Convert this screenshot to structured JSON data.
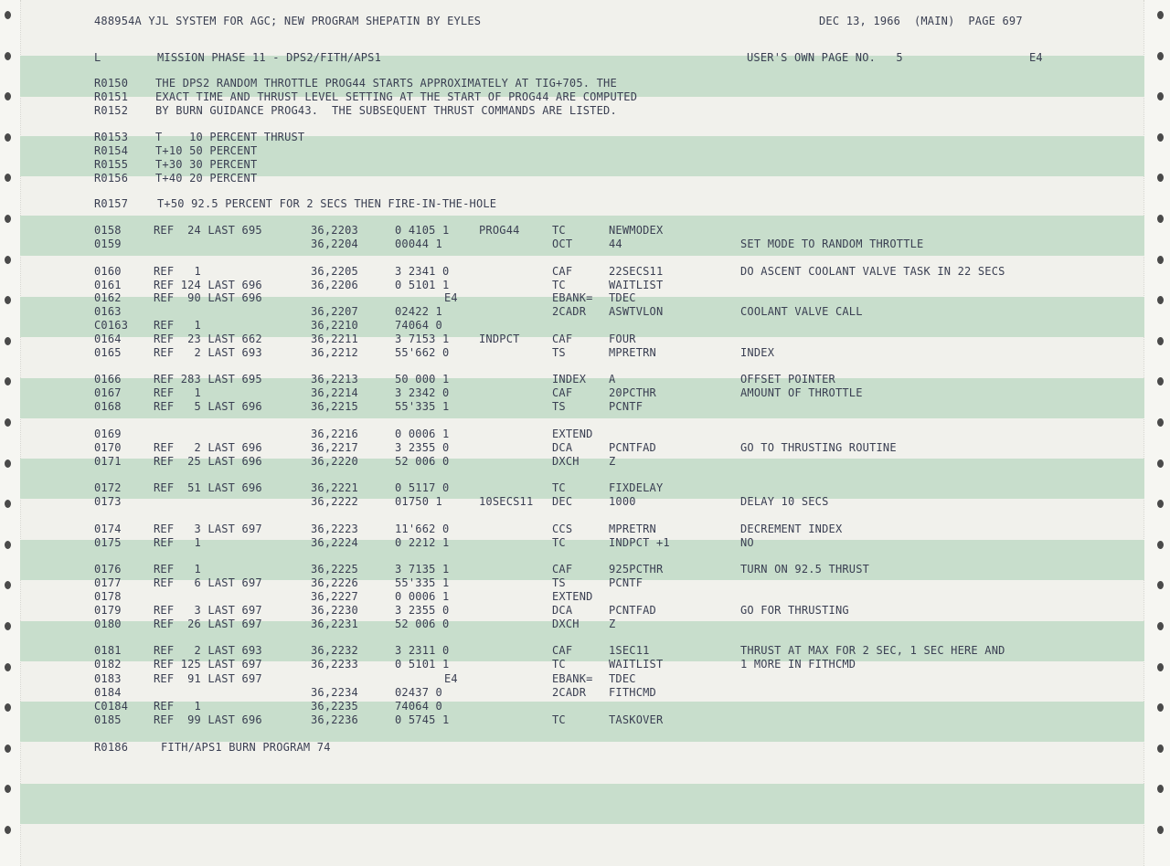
{
  "header": {
    "left": "488954A YJL SYSTEM FOR AGC; NEW PROGRAM SHEPATIN BY EYLES",
    "right": "DEC 13, 1966  (MAIN)  PAGE 697"
  },
  "subheader": {
    "left_label": "L",
    "title": "MISSION PHASE 11 - DPS2/FITH/APS1",
    "own_page": "USER'S OWN PAGE NO.   5",
    "tag": "E4"
  },
  "remarks_intro": [
    {
      "id": "R0150",
      "text": "THE DPS2 RANDOM THROTTLE PROG44 STARTS APPROXIMATELY AT TIG+705. THE"
    },
    {
      "id": "R0151",
      "text": "EXACT TIME AND THRUST LEVEL SETTING AT THE START OF PROG44 ARE COMPUTED"
    },
    {
      "id": "R0152",
      "text": "BY BURN GUIDANCE PROG43.  THE SUBSEQUENT THRUST COMMANDS ARE LISTED."
    }
  ],
  "remarks_thrust": [
    {
      "id": "R0153",
      "text": "T    10 PERCENT THRUST"
    },
    {
      "id": "R0154",
      "text": "T+10 50 PERCENT"
    },
    {
      "id": "R0155",
      "text": "T+30 30 PERCENT"
    },
    {
      "id": "R0156",
      "text": "T+40 20 PERCENT"
    }
  ],
  "remark_fire": {
    "id": "R0157",
    "text": "T+50 92.5 PERCENT FOR 2 SECS THEN FIRE-IN-THE-HOLE"
  },
  "code_lines": [
    {
      "line": "0158",
      "ref": "REF  24 LAST 695",
      "addr": "36,2203",
      "word": "0 4105 1",
      "label": "PROG44",
      "op": "TC",
      "operand": "NEWMODEX",
      "comment": ""
    },
    {
      "line": "0159",
      "ref": "",
      "addr": "36,2204",
      "word": "00044 1",
      "label": "",
      "op": "OCT",
      "operand": "44",
      "comment": "SET MODE TO RANDOM THROTTLE"
    },
    {
      "line": "0160",
      "ref": "REF   1",
      "addr": "36,2205",
      "word": "3 2341 0",
      "label": "",
      "op": "CAF",
      "operand": "22SECS11",
      "comment": "DO ASCENT COOLANT VALVE TASK IN 22 SECS"
    },
    {
      "line": "0161",
      "ref": "REF 124 LAST 696",
      "addr": "36,2206",
      "word": "0 5101 1",
      "label": "",
      "op": "TC",
      "operand": "WAITLIST",
      "comment": ""
    },
    {
      "line": "0162",
      "ref": "REF  90 LAST 696",
      "addr": "",
      "word": "E4",
      "label": "",
      "op": "EBANK=",
      "operand": "TDEC",
      "comment": ""
    },
    {
      "line": "0163",
      "ref": "",
      "addr": "36,2207",
      "word": "02422 1",
      "label": "",
      "op": "2CADR",
      "operand": "ASWTVLON",
      "comment": "COOLANT VALVE CALL"
    },
    {
      "line": "C0163",
      "ref": "REF   1",
      "addr": "36,2210",
      "word": "74064 0",
      "label": "",
      "op": "",
      "operand": "",
      "comment": ""
    },
    {
      "line": "0164",
      "ref": "REF  23 LAST 662",
      "addr": "36,2211",
      "word": "3 7153 1",
      "label": "INDPCT",
      "op": "CAF",
      "operand": "FOUR",
      "comment": ""
    },
    {
      "line": "0165",
      "ref": "REF   2 LAST 693",
      "addr": "36,2212",
      "word": "55'662 0",
      "label": "",
      "op": "TS",
      "operand": "MPRETRN",
      "comment": "INDEX"
    },
    {
      "line": "0166",
      "ref": "REF 283 LAST 695",
      "addr": "36,2213",
      "word": "50 000 1",
      "label": "",
      "op": "INDEX",
      "operand": "A",
      "comment": "OFFSET POINTER"
    },
    {
      "line": "0167",
      "ref": "REF   1",
      "addr": "36,2214",
      "word": "3 2342 0",
      "label": "",
      "op": "CAF",
      "operand": "20PCTHR",
      "comment": "AMOUNT OF THROTTLE"
    },
    {
      "line": "0168",
      "ref": "REF   5 LAST 696",
      "addr": "36,2215",
      "word": "55'335 1",
      "label": "",
      "op": "TS",
      "operand": "PCNTF",
      "comment": ""
    },
    {
      "line": "0169",
      "ref": "",
      "addr": "36,2216",
      "word": "0 0006 1",
      "label": "",
      "op": "EXTEND",
      "operand": "",
      "comment": ""
    },
    {
      "line": "0170",
      "ref": "REF   2 LAST 696",
      "addr": "36,2217",
      "word": "3 2355 0",
      "label": "",
      "op": "DCA",
      "operand": "PCNTFAD",
      "comment": "GO TO THRUSTING ROUTINE"
    },
    {
      "line": "0171",
      "ref": "REF  25 LAST 696",
      "addr": "36,2220",
      "word": "52 006 0",
      "label": "",
      "op": "DXCH",
      "operand": "Z",
      "comment": ""
    },
    {
      "line": "0172",
      "ref": "REF  51 LAST 696",
      "addr": "36,2221",
      "word": "0 5117 0",
      "label": "",
      "op": "TC",
      "operand": "FIXDELAY",
      "comment": ""
    },
    {
      "line": "0173",
      "ref": "",
      "addr": "36,2222",
      "word": "01750 1",
      "label": "10SECS11",
      "op": "DEC",
      "operand": "1000",
      "comment": "DELAY 10 SECS"
    },
    {
      "line": "0174",
      "ref": "REF   3 LAST 697",
      "addr": "36,2223",
      "word": "11'662 0",
      "label": "",
      "op": "CCS",
      "operand": "MPRETRN",
      "comment": "DECREMENT INDEX"
    },
    {
      "line": "0175",
      "ref": "REF   1",
      "addr": "36,2224",
      "word": "0 2212 1",
      "label": "",
      "op": "TC",
      "operand": "INDPCT +1",
      "comment": "NO"
    },
    {
      "line": "0176",
      "ref": "REF   1",
      "addr": "36,2225",
      "word": "3 7135 1",
      "label": "",
      "op": "CAF",
      "operand": "925PCTHR",
      "comment": "TURN ON 92.5 THRUST"
    },
    {
      "line": "0177",
      "ref": "REF   6 LAST 697",
      "addr": "36,2226",
      "word": "55'335 1",
      "label": "",
      "op": "TS",
      "operand": "PCNTF",
      "comment": ""
    },
    {
      "line": "0178",
      "ref": "",
      "addr": "36,2227",
      "word": "0 0006 1",
      "label": "",
      "op": "EXTEND",
      "operand": "",
      "comment": ""
    },
    {
      "line": "0179",
      "ref": "REF   3 LAST 697",
      "addr": "36,2230",
      "word": "3 2355 0",
      "label": "",
      "op": "DCA",
      "operand": "PCNTFAD",
      "comment": "GO FOR THRUSTING"
    },
    {
      "line": "0180",
      "ref": "REF  26 LAST 697",
      "addr": "36,2231",
      "word": "52 006 0",
      "label": "",
      "op": "DXCH",
      "operand": "Z",
      "comment": ""
    },
    {
      "line": "0181",
      "ref": "REF   2 LAST 693",
      "addr": "36,2232",
      "word": "3 2311 0",
      "label": "",
      "op": "CAF",
      "operand": "1SEC11",
      "comment": "THRUST AT MAX FOR 2 SEC, 1 SEC HERE AND"
    },
    {
      "line": "0182",
      "ref": "REF 125 LAST 697",
      "addr": "36,2233",
      "word": "0 5101 1",
      "label": "",
      "op": "TC",
      "operand": "WAITLIST",
      "comment": "1 MORE IN FITHCMD"
    },
    {
      "line": "0183",
      "ref": "REF  91 LAST 697",
      "addr": "",
      "word": "E4",
      "label": "",
      "op": "EBANK=",
      "operand": "TDEC",
      "comment": ""
    },
    {
      "line": "0184",
      "ref": "",
      "addr": "36,2234",
      "word": "02437 0",
      "label": "",
      "op": "2CADR",
      "operand": "FITHCMD",
      "comment": ""
    },
    {
      "line": "C0184",
      "ref": "REF   1",
      "addr": "36,2235",
      "word": "74064 0",
      "label": "",
      "op": "",
      "operand": "",
      "comment": ""
    },
    {
      "line": "0185",
      "ref": "REF  99 LAST 696",
      "addr": "36,2236",
      "word": "0 5745 1",
      "label": "",
      "op": "TC",
      "operand": "TASKOVER",
      "comment": ""
    }
  ],
  "remark_end": {
    "id": "R0186",
    "text": "FITH/APS1 BURN PROGRAM 74"
  }
}
